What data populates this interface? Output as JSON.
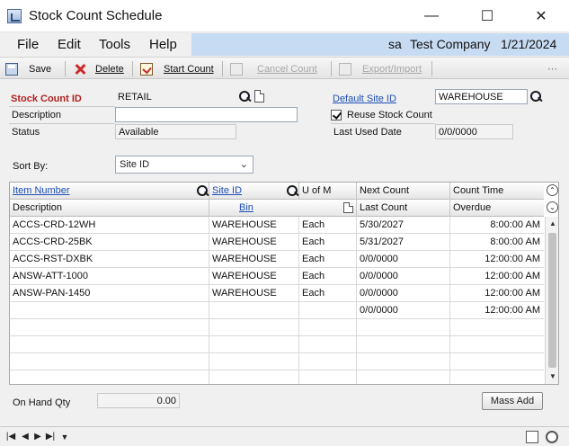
{
  "window": {
    "title": "Stock Count Schedule",
    "controls": {
      "minimize": "—",
      "maximize": "☐",
      "close": "✕"
    }
  },
  "menu": {
    "items": [
      "File",
      "Edit",
      "Tools",
      "Help"
    ],
    "user": "sa",
    "company": "Test Company",
    "date": "1/21/2024"
  },
  "toolbar": {
    "save": "Save",
    "delete": "Delete",
    "start_count": "Start Count",
    "cancel_count": "Cancel Count",
    "export_import": "Export/Import"
  },
  "form": {
    "stock_count_id_label": "Stock Count ID",
    "stock_count_id": "RETAIL",
    "description_label": "Description",
    "description": "",
    "status_label": "Status",
    "status": "Available",
    "default_site_label": "Default Site ID",
    "default_site": "WAREHOUSE",
    "reuse_label": "Reuse Stock Count",
    "reuse_checked": true,
    "last_used_label": "Last Used Date",
    "last_used": "0/0/0000",
    "sort_by_label": "Sort By:",
    "sort_by": "Site ID"
  },
  "grid": {
    "headers_row1": [
      "Item Number",
      "Site ID",
      "U of M",
      "Next Count",
      "Count Time"
    ],
    "headers_row2": [
      "Description",
      "Bin",
      "Last Count",
      "Overdue"
    ],
    "rows": [
      {
        "item": "ACCS-CRD-12WH",
        "site": "WAREHOUSE",
        "uom": "Each",
        "date": "5/30/2027",
        "time": "8:00:00 AM"
      },
      {
        "item": "ACCS-CRD-25BK",
        "site": "WAREHOUSE",
        "uom": "Each",
        "date": "5/31/2027",
        "time": "8:00:00 AM"
      },
      {
        "item": "ACCS-RST-DXBK",
        "site": "WAREHOUSE",
        "uom": "Each",
        "date": "0/0/0000",
        "time": "12:00:00 AM"
      },
      {
        "item": "ANSW-ATT-1000",
        "site": "WAREHOUSE",
        "uom": "Each",
        "date": "0/0/0000",
        "time": "12:00:00 AM"
      },
      {
        "item": "ANSW-PAN-1450",
        "site": "WAREHOUSE",
        "uom": "Each",
        "date": "0/0/0000",
        "time": "12:00:00 AM"
      },
      {
        "item": "",
        "site": "",
        "uom": "",
        "date": "0/0/0000",
        "time": "12:00:00 AM"
      }
    ]
  },
  "bottom": {
    "on_hand_label": "On Hand Qty",
    "on_hand_value": "0.00",
    "mass_add": "Mass Add"
  }
}
